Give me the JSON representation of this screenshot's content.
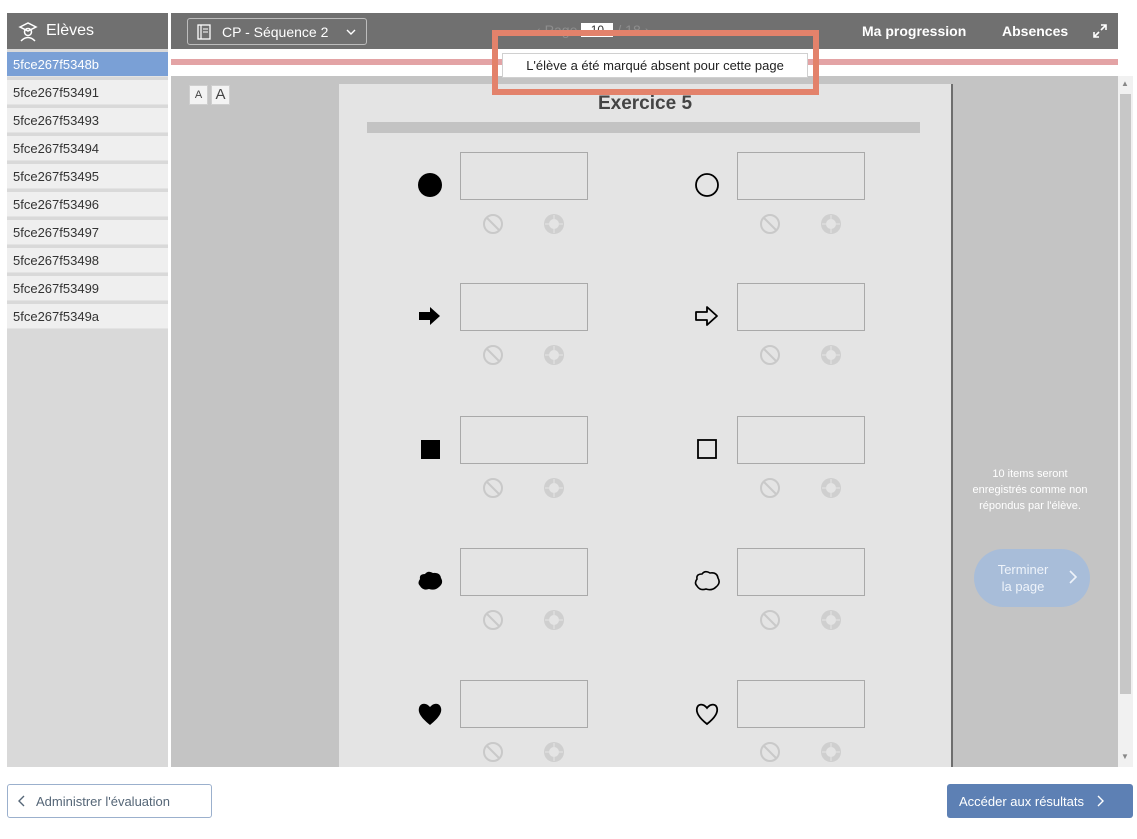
{
  "sidebar": {
    "title": "Elèves",
    "students": [
      "5fce267f5348b",
      "5fce267f53491",
      "5fce267f53493",
      "5fce267f53494",
      "5fce267f53495",
      "5fce267f53496",
      "5fce267f53497",
      "5fce267f53498",
      "5fce267f53499",
      "5fce267f5349a"
    ],
    "active_index": 0
  },
  "topbar": {
    "sequence": "CP - Séquence 2",
    "pager_prev": "‹",
    "pager_label": "Page",
    "page_current": "10",
    "page_total_label": "/ 18",
    "pager_next": "›",
    "progression": "Ma progression",
    "absences": "Absences"
  },
  "notice": "L'élève a été marqué absent pour cette page",
  "font_buttons": {
    "small": "A",
    "large": "A"
  },
  "sheet": {
    "title": "Exercice 5",
    "items": [
      {
        "shape": "filled-circle"
      },
      {
        "shape": "outline-circle"
      },
      {
        "shape": "filled-arrow"
      },
      {
        "shape": "outline-arrow"
      },
      {
        "shape": "filled-square"
      },
      {
        "shape": "outline-square"
      },
      {
        "shape": "filled-cloud"
      },
      {
        "shape": "outline-cloud"
      },
      {
        "shape": "filled-heart"
      },
      {
        "shape": "outline-heart"
      }
    ]
  },
  "right_panel": {
    "note": "10 items seront enregistrés comme non répondus par l'élève.",
    "finish_line1": "Terminer",
    "finish_line2": "la page"
  },
  "footer": {
    "admin_button": "Administrer l'évaluation",
    "results_button": "Accéder aux résultats"
  },
  "colors": {
    "accent": "#5d80b4",
    "highlight": "#e3826b",
    "active_student": "#7aa0d6"
  }
}
